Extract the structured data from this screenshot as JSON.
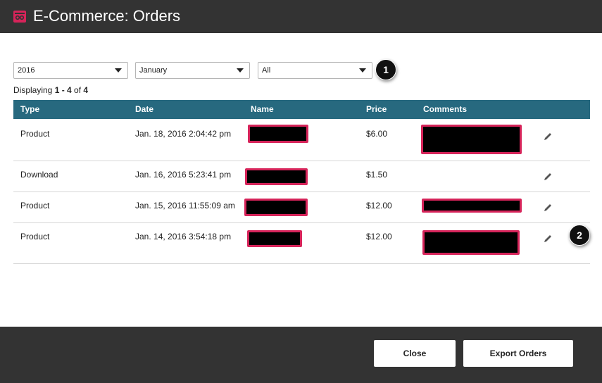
{
  "header": {
    "title": "E-Commerce: Orders",
    "logo_icon": "ecommerce-logo-icon",
    "accent": "#d6245a"
  },
  "filters": {
    "year": {
      "value": "2016"
    },
    "month": {
      "value": "January"
    },
    "type": {
      "value": "All"
    }
  },
  "callouts": {
    "first": "1",
    "second": "2"
  },
  "summary": {
    "prefix": "Displaying ",
    "range": "1 - 4",
    "of": " of ",
    "total": "4"
  },
  "table": {
    "header_color": "#27697f",
    "columns": {
      "type": "Type",
      "date": "Date",
      "name": "Name",
      "price": "Price",
      "comments": "Comments"
    },
    "rows": [
      {
        "type": "Product",
        "date": "Jan. 18, 2016 2:04:42 pm",
        "price": "$6.00"
      },
      {
        "type": "Download",
        "date": "Jan. 16, 2016 5:23:41 pm",
        "price": "$1.50"
      },
      {
        "type": "Product",
        "date": "Jan. 15, 2016 11:55:09 am",
        "price": "$12.00"
      },
      {
        "type": "Product",
        "date": "Jan. 14, 2016 3:54:18 pm",
        "price": "$12.00"
      }
    ]
  },
  "buttons": {
    "close": "Close",
    "export": "Export Orders"
  }
}
